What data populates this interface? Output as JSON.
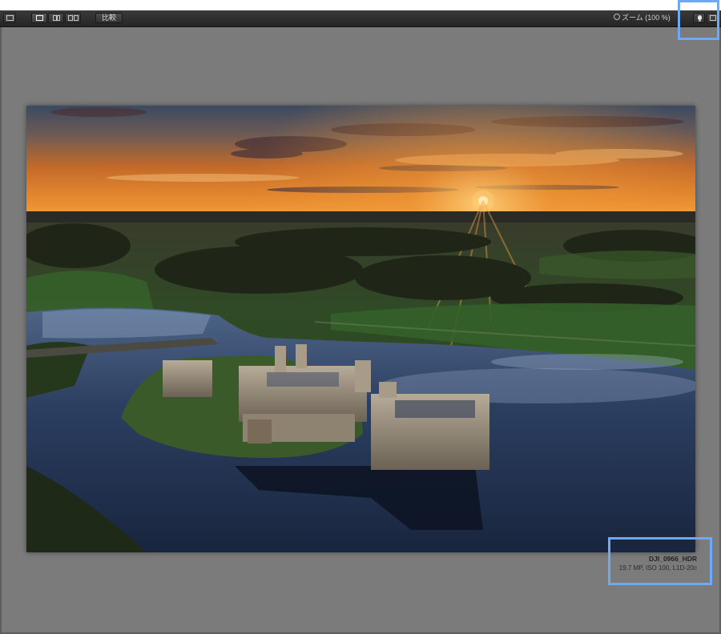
{
  "toolbar": {
    "compare_label": "比較",
    "zoom_label": "ズーム (100 %)"
  },
  "photo": {
    "name": "DJI_0966_HDR",
    "meta": "19.7 MP, ISO 100, L1D-20c"
  },
  "icons": {
    "sidebar_toggle": "sidebar-toggle-icon",
    "single_view": "single-view-icon",
    "split_view": "split-view-icon",
    "dual_view": "dual-view-icon",
    "lightbulb": "lightbulb-icon",
    "panel_toggle": "panel-toggle-icon"
  },
  "colors": {
    "highlight": "#6fa8f5",
    "canvas": "#7b7b7b",
    "toolbar": "#2e2e2e"
  }
}
